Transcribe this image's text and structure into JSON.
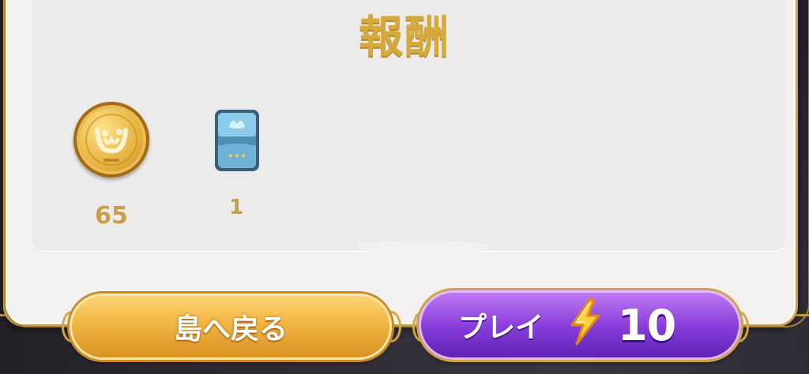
{
  "title": "報酬",
  "rewards": [
    {
      "icon": "gold-coin-icon",
      "count": "65"
    },
    {
      "icon": "blue-card-pack-icon",
      "count": "1"
    }
  ],
  "buttons": {
    "back_label": "島へ戻る",
    "play_label": "プレイ",
    "play_cost_icon": "lightning-bolt-icon",
    "play_cost": "10"
  },
  "colors": {
    "title_gold": "#d5a93d",
    "back_button": "#f1b543",
    "play_button": "#8a3fdc",
    "panel": "#f2f1ef"
  }
}
